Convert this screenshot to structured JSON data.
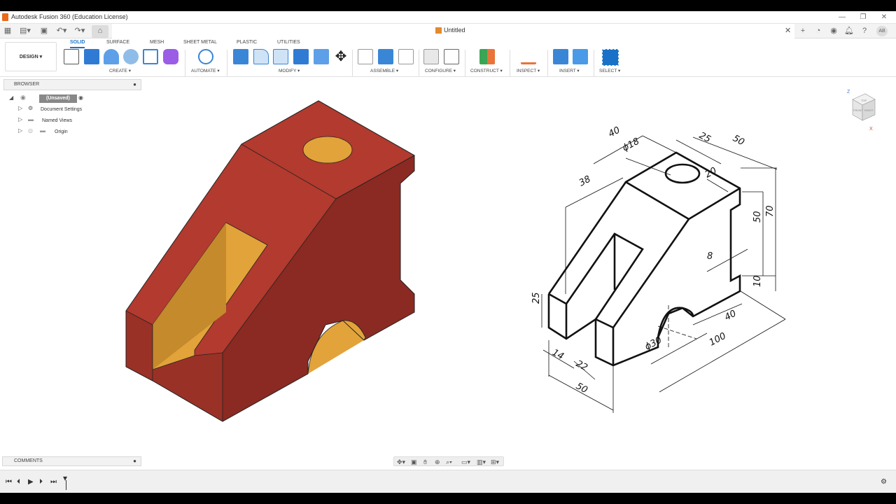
{
  "window": {
    "title": "Autodesk Fusion 360 (Education License)",
    "document_title": "Untitled"
  },
  "workspace": {
    "label": "DESIGN ▾"
  },
  "menu_tabs": [
    "SOLID",
    "SURFACE",
    "MESH",
    "SHEET METAL",
    "PLASTIC",
    "UTILITIES"
  ],
  "tool_groups": [
    "CREATE ▾",
    "AUTOMATE ▾",
    "MODIFY ▾",
    "ASSEMBLE ▾",
    "CONFIGURE ▾",
    "CONSTRUCT ▾",
    "INSPECT ▾",
    "INSERT ▾",
    "SELECT ▾"
  ],
  "browser": {
    "title": "BROWSER",
    "root": "(Unsaved)",
    "items": [
      "Document Settings",
      "Named Views",
      "Origin"
    ]
  },
  "comments": {
    "title": "COMMENTS"
  },
  "user": {
    "initials": "AB"
  },
  "viewcube": {
    "top": "TOP",
    "front": "FRONT",
    "right": "RIGHT",
    "axis_z": "Z",
    "axis_x": "X"
  },
  "drawing": {
    "dims": [
      "40",
      "ϕ18",
      "25",
      "50",
      "38",
      "20",
      "50",
      "70",
      "8",
      "25",
      "10",
      "40",
      "100",
      "ϕ30",
      "14",
      "22",
      "50"
    ]
  },
  "colors": {
    "part_face": "#b23a2e",
    "part_dark": "#8a2a22",
    "hole": "#e2a33a",
    "accent": "#1a72c8"
  }
}
